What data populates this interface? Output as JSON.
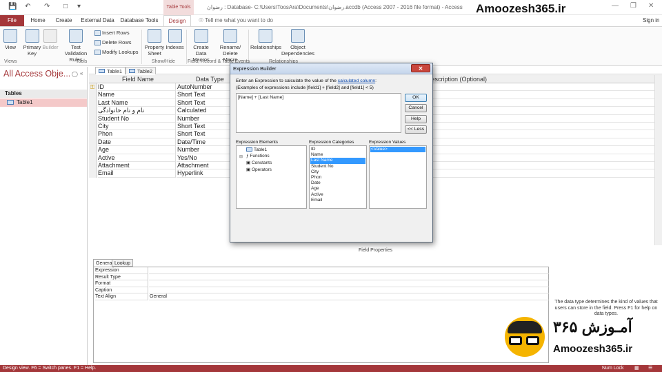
{
  "titlebar": {
    "title": "رضوان : Database- C:\\Users\\ToosAra\\Documents\\رضوان.accdb (Access 2007 - 2016 file format) - Access",
    "table_tools": "Table Tools",
    "watermark": "Amoozesh365.ir"
  },
  "tabs": {
    "file": "File",
    "home": "Home",
    "create": "Create",
    "external": "External Data",
    "dbtools": "Database Tools",
    "design": "Design",
    "tellme": "Tell me what you want to do",
    "signin": "Sign in"
  },
  "ribbon": {
    "view": "View",
    "primary_key": "Primary Key",
    "builder": "Builder",
    "test_rules": "Test Validation Rules",
    "insert_rows": "Insert Rows",
    "delete_rows": "Delete Rows",
    "modify_lookups": "Modify Lookups",
    "property_sheet": "Property Sheet",
    "indexes": "Indexes",
    "create_macros": "Create Data Macros",
    "rename_macro": "Rename/ Delete Macro",
    "relationships": "Relationships",
    "object_deps": "Object Dependencies",
    "grp_views": "Views",
    "grp_tools": "Tools",
    "grp_showhide": "Show/Hide",
    "grp_events": "Field, Record & Table Events",
    "grp_relationships": "Relationships"
  },
  "nav": {
    "title": "All Access Obje...",
    "section": "Tables",
    "item": "Table1"
  },
  "doctabs": [
    "Table1",
    "Table2"
  ],
  "grid": {
    "headers": {
      "field": "Field Name",
      "type": "Data Type",
      "desc": "Description (Optional)"
    },
    "rows": [
      {
        "name": "ID",
        "type": "AutoNumber"
      },
      {
        "name": "Name",
        "type": "Short Text"
      },
      {
        "name": "Last Name",
        "type": "Short Text"
      },
      {
        "name": "نام و نام خانوادگی",
        "type": "Calculated"
      },
      {
        "name": "Student No",
        "type": "Number"
      },
      {
        "name": "City",
        "type": "Short Text"
      },
      {
        "name": "Phon",
        "type": "Short Text"
      },
      {
        "name": "Date",
        "type": "Date/Time"
      },
      {
        "name": "Age",
        "type": "Number"
      },
      {
        "name": "Active",
        "type": "Yes/No"
      },
      {
        "name": "Attachment",
        "type": "Attachment"
      },
      {
        "name": "Email",
        "type": "Hyperlink"
      }
    ]
  },
  "field_properties": {
    "label": "Field Properties",
    "tab_general": "General",
    "tab_lookup": "Lookup",
    "rows": [
      {
        "key": "Expression",
        "value": ""
      },
      {
        "key": "Result Type",
        "value": ""
      },
      {
        "key": "Format",
        "value": ""
      },
      {
        "key": "Caption",
        "value": ""
      },
      {
        "key": "Text Align",
        "value": "General"
      }
    ],
    "help": "The data type determines the kind of values that users can store in the field. Press F1 for help on data types."
  },
  "dialog": {
    "title": "Expression Builder",
    "intro": "Enter an Expression to calculate the value of the",
    "intro_link": "calculated column",
    "examples": "(Examples of expressions include [field1] + [field2] and [field1] < 5)",
    "expression": "[Name] + [Last Name]",
    "buttons": {
      "ok": "OK",
      "cancel": "Cancel",
      "help": "Help",
      "less": "<< Less"
    },
    "lbl_elements": "Expression Elements",
    "lbl_categories": "Expression Categories",
    "lbl_values": "Expression Values",
    "elements": [
      "Table1",
      "Functions",
      "Constants",
      "Operators"
    ],
    "categories": [
      "ID",
      "Name",
      "Last Name",
      "Student No",
      "City",
      "Phon",
      "Date",
      "Age",
      "Active",
      "Email"
    ],
    "selected_category": "Last Name",
    "values": [
      "<Value>"
    ]
  },
  "statusbar": {
    "left": "Design view.  F6 = Switch panes.  F1 = Help.",
    "numlock": "Num Lock"
  },
  "logo": {
    "fa": "آمـوزش ۳۶۵",
    "en": "Amoozesh365.ir"
  },
  "colors": {
    "accent": "#a4373a",
    "selection": "#3399ff",
    "nav_selected": "#f4c9c9"
  }
}
